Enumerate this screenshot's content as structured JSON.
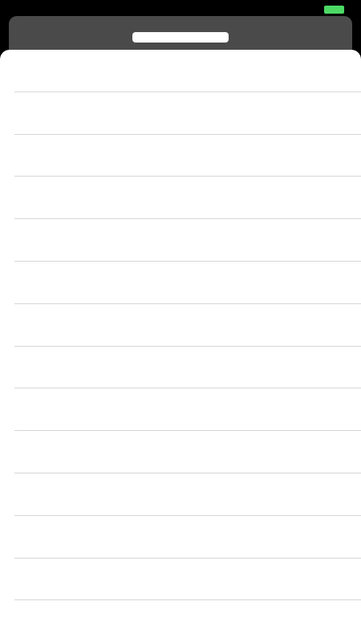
{
  "colors": {
    "background": "#000000",
    "battery": "#4cd964",
    "back_card": "#4a4a4a",
    "sheet": "#ffffff",
    "separator": "#d6d6d6"
  },
  "status_bar": {
    "battery_icon": "battery-full-icon"
  },
  "list": {
    "rows": [
      "",
      "",
      "",
      "",
      "",
      "",
      "",
      "",
      "",
      "",
      "",
      "",
      "",
      ""
    ]
  }
}
